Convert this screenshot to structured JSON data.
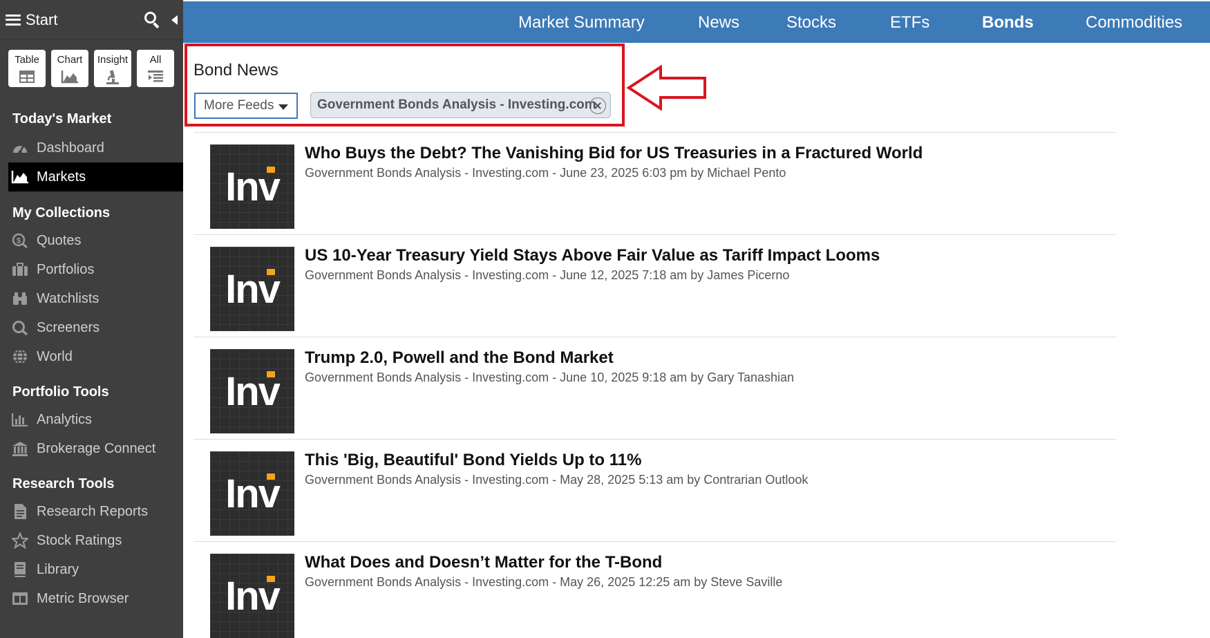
{
  "sidebar": {
    "start_label": "Start",
    "view_buttons": [
      {
        "label": "Table",
        "icon": "table-icon"
      },
      {
        "label": "Chart",
        "icon": "chart-icon"
      },
      {
        "label": "Insight",
        "icon": "microscope-icon"
      },
      {
        "label": "All",
        "icon": "list-icon"
      }
    ],
    "sections": [
      {
        "title": "Today's Market",
        "items": [
          {
            "label": "Dashboard",
            "icon": "dashboard-icon"
          },
          {
            "label": "Markets",
            "icon": "area-chart-icon",
            "active": true
          }
        ]
      },
      {
        "title": "My Collections",
        "items": [
          {
            "label": "Quotes",
            "icon": "dollar-search-icon"
          },
          {
            "label": "Portfolios",
            "icon": "briefcase-icon"
          },
          {
            "label": "Watchlists",
            "icon": "binoculars-icon"
          },
          {
            "label": "Screeners",
            "icon": "search-icon"
          },
          {
            "label": "World",
            "icon": "globe-icon"
          }
        ]
      },
      {
        "title": "Portfolio Tools",
        "items": [
          {
            "label": "Analytics",
            "icon": "bar-chart-icon"
          },
          {
            "label": "Brokerage Connect",
            "icon": "bank-icon"
          }
        ]
      },
      {
        "title": "Research Tools",
        "items": [
          {
            "label": "Research Reports",
            "icon": "document-icon"
          },
          {
            "label": "Stock Ratings",
            "icon": "star-icon"
          },
          {
            "label": "Library",
            "icon": "book-icon"
          },
          {
            "label": "Metric Browser",
            "icon": "columns-icon"
          }
        ]
      }
    ]
  },
  "topnav": {
    "items": [
      "Market Summary",
      "News",
      "Stocks",
      "ETFs",
      "Bonds",
      "Commodities"
    ],
    "active": "Bonds"
  },
  "bond_news": {
    "title": "Bond News",
    "more_feeds_label": "More Feeds",
    "feed_chip": "Government Bonds Analysis - Investing.com"
  },
  "news": [
    {
      "title": "Who Buys the Debt? The Vanishing Bid for US Treasuries in a Fractured World",
      "meta": "Government Bonds Analysis - Investing.com - June 23, 2025 6:03 pm by Michael Pento",
      "thumb": "Inv"
    },
    {
      "title": "US 10-Year Treasury Yield Stays Above Fair Value as Tariff Impact Looms",
      "meta": "Government Bonds Analysis - Investing.com - June 12, 2025 7:18 am by James Picerno",
      "thumb": "Inv"
    },
    {
      "title": "Trump 2.0, Powell and the Bond Market",
      "meta": "Government Bonds Analysis - Investing.com - June 10, 2025 9:18 am by Gary Tanashian",
      "thumb": "Inv"
    },
    {
      "title": "This 'Big, Beautiful' Bond Yields Up to 11%",
      "meta": "Government Bonds Analysis - Investing.com - May 28, 2025 5:13 am by Contrarian Outlook",
      "thumb": "Inv"
    },
    {
      "title": "What Does and Doesn’t Matter for the T-Bond",
      "meta": "Government Bonds Analysis - Investing.com - May 26, 2025 12:25 am by Steve Saville",
      "thumb": "Inv"
    }
  ],
  "colors": {
    "sidebar_bg": "#3f3f3f",
    "nav_bg": "#3d7ab8",
    "annotation_red": "#d9151f",
    "logo_accent": "#f7a21b"
  }
}
